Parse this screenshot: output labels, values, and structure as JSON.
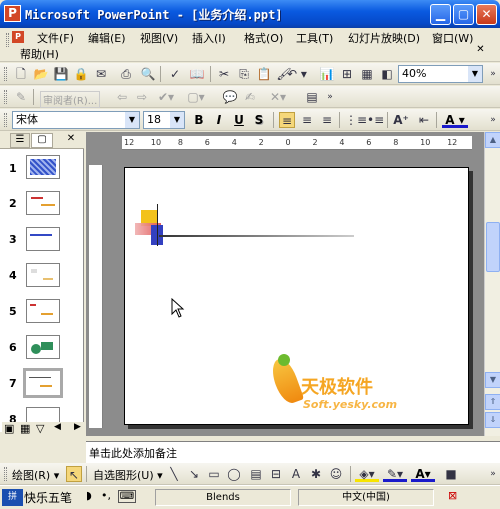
{
  "window": {
    "title": "Microsoft PowerPoint - [业务介绍.ppt]",
    "app_icon": "P"
  },
  "menu": {
    "items": [
      "文件(F)",
      "编辑(E)",
      "视图(V)",
      "插入(I)",
      "格式(O)",
      "工具(T)",
      "幻灯片放映(D)",
      "窗口(W)",
      "帮助(H)"
    ]
  },
  "standard_toolbar": {
    "zoom": "40%"
  },
  "review_toolbar": {
    "reviewer_label": "审阅者(R)..."
  },
  "format_toolbar": {
    "font": "宋体",
    "size": "18",
    "bold": "B",
    "italic": "I",
    "underline": "U",
    "shadow": "S"
  },
  "pane_tabs": {
    "outline": "☰",
    "slides": "▢",
    "close": "✕"
  },
  "slides": [
    {
      "number": "1"
    },
    {
      "number": "2"
    },
    {
      "number": "3"
    },
    {
      "number": "4"
    },
    {
      "number": "5"
    },
    {
      "number": "6"
    },
    {
      "number": "7",
      "selected": true
    },
    {
      "number": "8"
    }
  ],
  "ruler": {
    "h_labels": [
      "12",
      "10",
      "8",
      "6",
      "4",
      "2",
      "0",
      "2",
      "4",
      "6",
      "8",
      "10",
      "12"
    ]
  },
  "watermark": {
    "cn": "天极软件",
    "en": "Soft.yesky.com"
  },
  "notes": {
    "placeholder": "单击此处添加备注"
  },
  "drawing_toolbar": {
    "draw": "绘图(R)",
    "autoshapes": "自选图形(U)"
  },
  "statusbar": {
    "ime_name": "快乐五笔",
    "design": "Blends",
    "language": "中文(中国)"
  },
  "colors": {
    "title_blue": "#0a5ae0",
    "accent_red": "#d24726"
  }
}
